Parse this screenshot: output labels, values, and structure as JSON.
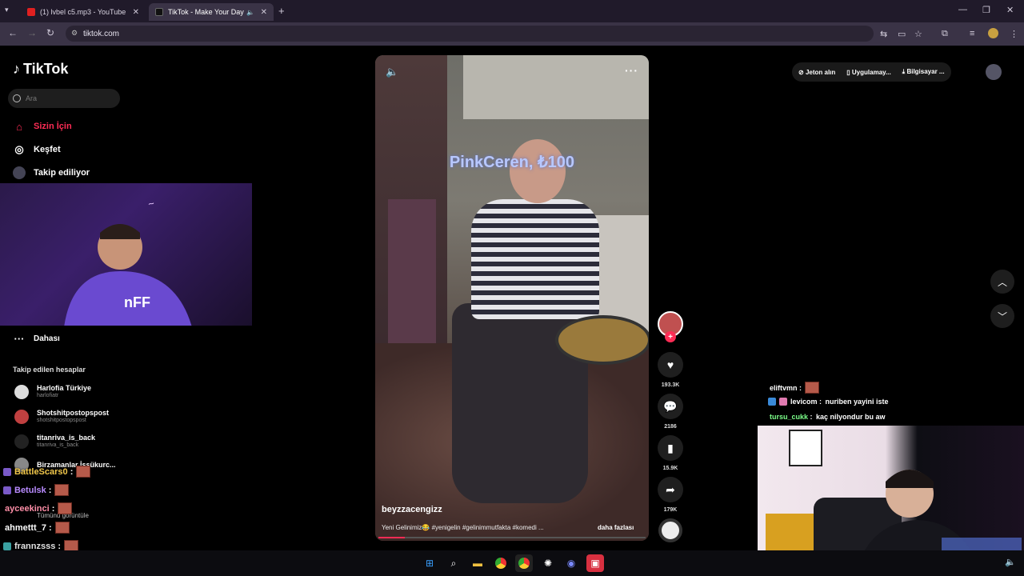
{
  "browser": {
    "tabs": [
      {
        "title": "(1) lvbel c5.mp3 - YouTube",
        "icon": "youtube-icon",
        "active": false
      },
      {
        "title": "TikTok - Make Your Day",
        "icon": "tiktok-icon",
        "active": true
      }
    ],
    "url": "tiktok.com"
  },
  "tiktok": {
    "logo": "TikTok",
    "search_placeholder": "Ara",
    "nav": [
      {
        "label": "Sizin İçin",
        "icon": "home-icon",
        "active": true
      },
      {
        "label": "Keşfet",
        "icon": "compass-icon",
        "active": false
      },
      {
        "label": "Takip ediliyor",
        "icon": "following-icon",
        "active": false
      }
    ],
    "more_label": "Dahası",
    "following_title": "Takip edilen hesaplar",
    "following": [
      {
        "name": "Harlofia Türkiye",
        "handle": "harlofiatr"
      },
      {
        "name": "Shotshitpostopspost",
        "handle": "shotshitpostopspost"
      },
      {
        "name": "titanriva_is_back",
        "handle": "titanriva_is_back"
      },
      {
        "name": "Birzamanlar İşşükurc...",
        "handle": ""
      }
    ],
    "see_all": "Tümünü görüntüle",
    "header": {
      "coins": "Jeton alın",
      "app": "Uygulamay...",
      "computer": "Bilgisayar ..."
    },
    "video": {
      "donation": "PinkCeren, ₺100",
      "author": "beyzzacengizz",
      "caption": "Yeni Gelinimiz😂 #yenigelin #gelinimmutfakta #komedi ...",
      "more_link": "daha fazlası",
      "likes": "193.3K",
      "comments": "2186",
      "saves": "15.9K",
      "shares": "179K"
    }
  },
  "chat_left": [
    {
      "user": "BattleScars0",
      "color": "#f2c84b"
    },
    {
      "user": "Betulsk",
      "color": "#b98bff"
    },
    {
      "user": "ayceekinci",
      "color": "#ff8fa8"
    },
    {
      "user": "ahmettt_7",
      "color": "#ffffff"
    },
    {
      "user": "frannzsss",
      "color": "#e0e0e0"
    }
  ],
  "chat_right": [
    {
      "user": "eliftvmn",
      "color": "#ffffff",
      "message": ""
    },
    {
      "user": "levicom",
      "color": "#ffffff",
      "message": "nuriben yayini iste"
    },
    {
      "user": "tursu_cukk",
      "color": "#7cff8a",
      "message": "kaç nilyondur bu aw"
    }
  ],
  "colors": {
    "accent": "#fe2c55",
    "donation": "#b8c8ff"
  }
}
